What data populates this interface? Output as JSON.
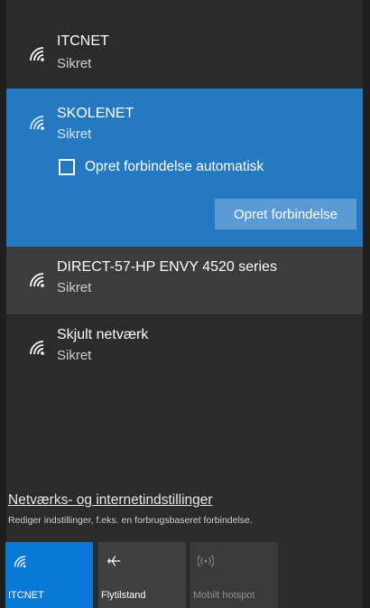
{
  "networks": [
    {
      "name": "ITCNET",
      "status": "Sikret",
      "icon": "wifi-icon"
    },
    {
      "name": "SKOLENET",
      "status": "Sikret",
      "icon": "wifi-icon",
      "auto_connect_label": "Opret forbindelse automatisk",
      "connect_label": "Opret forbindelse"
    },
    {
      "name": "DIRECT-57-HP ENVY 4520 series",
      "status": "Sikret",
      "icon": "wifi-icon"
    },
    {
      "name": "Skjult netværk",
      "status": "Sikret",
      "icon": "wifi-icon"
    }
  ],
  "settings": {
    "link": "Netværks- og internetindstillinger",
    "description": "Rediger indstillinger, f.eks. en forbrugsbaseret forbindelse."
  },
  "quick_actions": [
    {
      "label": "ITCNET",
      "icon": "wifi-icon",
      "active": true
    },
    {
      "label": "Flytilstand",
      "icon": "airplane-icon",
      "active": false
    },
    {
      "label": "Mobilt hotspot",
      "icon": "hotspot-icon",
      "active": false,
      "disabled": true
    }
  ],
  "colors": {
    "accent": "#2479c0",
    "tile_active": "#0a78d7",
    "panel_bg": "#2b2b2b"
  }
}
